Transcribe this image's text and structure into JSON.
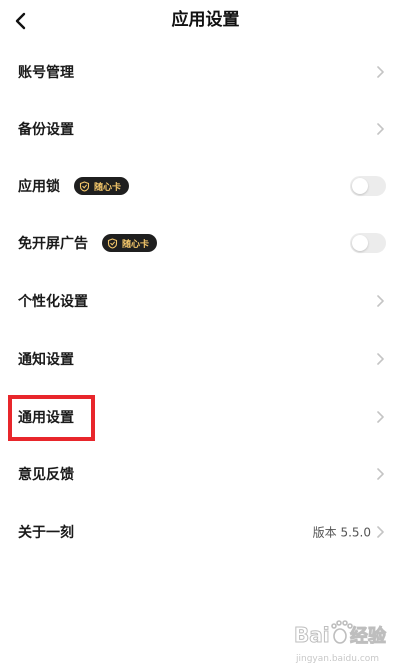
{
  "header": {
    "title": "应用设置",
    "back_icon": "chevron-left-icon"
  },
  "settings": {
    "account": {
      "label": "账号管理"
    },
    "backup": {
      "label": "备份设置"
    },
    "app_lock": {
      "label": "应用锁",
      "badge": "随心卡",
      "toggle_on": false
    },
    "no_splash_ad": {
      "label": "免开屏广告",
      "badge": "随心卡",
      "toggle_on": false
    },
    "personalization": {
      "label": "个性化设置"
    },
    "notifications": {
      "label": "通知设置"
    },
    "general": {
      "label": "通用设置",
      "highlighted": true
    },
    "feedback": {
      "label": "意见反馈"
    },
    "about": {
      "label": "关于一刻",
      "version": "版本 5.5.0"
    }
  },
  "colors": {
    "highlight": "#e8262b",
    "badge_bg": "#1f1f1f",
    "badge_text": "#f3c66a",
    "toggle_off": "#ececec"
  },
  "watermark": {
    "logo_text": "Baidu经验",
    "url": "jingyan.baidu.com"
  }
}
